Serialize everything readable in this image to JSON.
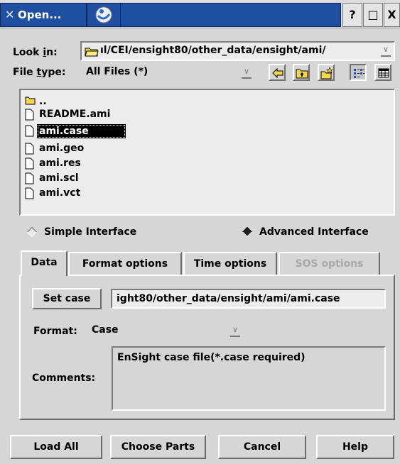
{
  "window": {
    "title": "Open...",
    "help_glyph": "?",
    "maximize_glyph": "□",
    "close_glyph": "X"
  },
  "look_in": {
    "label_pre": "Look ",
    "label_u": "i",
    "label_post": "n:",
    "value": "ıl/CEI/ensight80/other_data/ensight/ami/"
  },
  "file_type": {
    "label_pre": "File ",
    "label_u": "t",
    "label_post": "ype:",
    "value": "All Files (*)"
  },
  "toolbar": {
    "back_icon": "arrow-left-icon",
    "up_icon": "folder-up-icon",
    "new_folder_icon": "new-folder-icon",
    "list_view_icon": "list-view-icon",
    "detail_view_icon": "detail-view-icon"
  },
  "files": [
    {
      "name": "..",
      "icon": "folder-icon"
    },
    {
      "name": "README.ami",
      "icon": "file-icon"
    },
    {
      "name": "ami.case",
      "icon": "file-icon",
      "selected": true
    },
    {
      "name": "ami.geo",
      "icon": "file-icon"
    },
    {
      "name": "ami.res",
      "icon": "file-icon"
    },
    {
      "name": "ami.scl",
      "icon": "file-icon"
    },
    {
      "name": "ami.vct",
      "icon": "file-icon"
    }
  ],
  "interface_mode": {
    "simple": "Simple Interface",
    "advanced": "Advanced Interface",
    "selected": "advanced"
  },
  "tabs": [
    {
      "label": "Data",
      "active": true
    },
    {
      "label": "Format options"
    },
    {
      "label": "Time options"
    },
    {
      "label": "SOS options",
      "disabled": true
    }
  ],
  "data_tab": {
    "set_case_label": "Set case",
    "case_path": "ight80/other_data/ensight/ami/ami.case",
    "format_label": "Format:",
    "format_value": "Case",
    "comments_label": "Comments:",
    "comments_text": "EnSight case file(*.case required)"
  },
  "footer": {
    "load_all": "Load All",
    "choose_parts": "Choose Parts",
    "cancel": "Cancel",
    "help": "Help"
  },
  "colors": {
    "titlebar": "#1f4fa0",
    "dialog_bg": "#d6d6d6",
    "field_bg": "#ececec",
    "selection": "#000000"
  }
}
